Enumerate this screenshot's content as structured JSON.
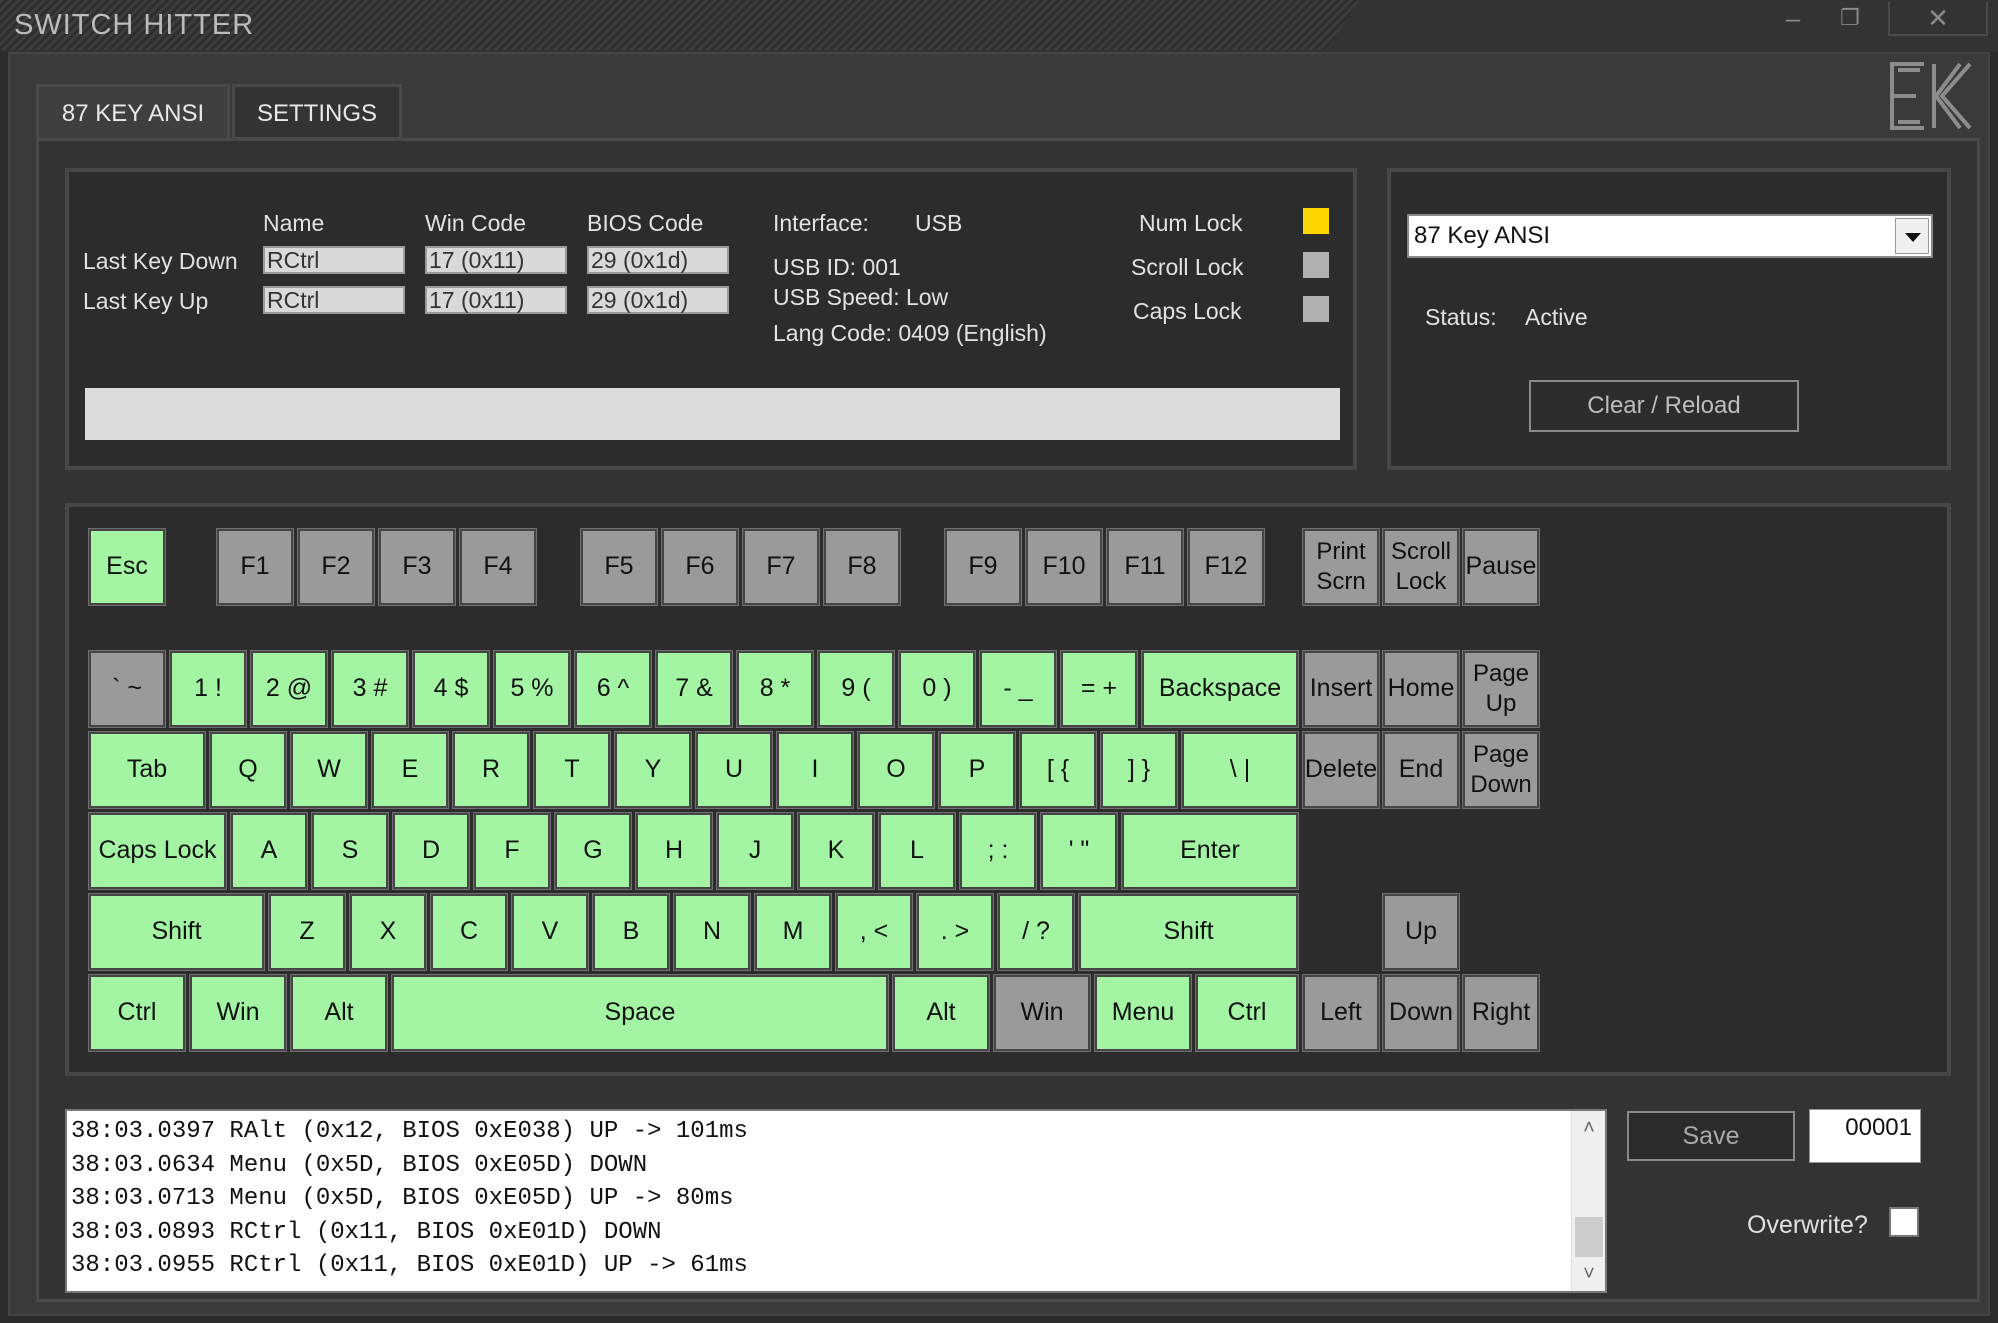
{
  "window": {
    "title": "SWITCH HITTER",
    "controls": {
      "minimize": "–",
      "maximize": "❐",
      "close": "✕"
    }
  },
  "tabs": [
    {
      "label": "87 KEY ANSI",
      "active": true
    },
    {
      "label": "SETTINGS",
      "active": false
    }
  ],
  "logo": "EK",
  "info": {
    "headers": {
      "name": "Name",
      "win_code": "Win Code",
      "bios_code": "BIOS Code"
    },
    "last_key_down": {
      "label": "Last Key Down",
      "name": "RCtrl",
      "win_code": "17 (0x11)",
      "bios_code": "29 (0x1d)"
    },
    "last_key_up": {
      "label": "Last Key Up",
      "name": "RCtrl",
      "win_code": "17 (0x11)",
      "bios_code": "29 (0x1d)"
    },
    "interface_label": "Interface:",
    "interface_value": "USB",
    "usb_id": "USB ID:  001",
    "usb_speed": "USB Speed:  Low",
    "lang_code": "Lang Code:  0409 (English)",
    "locks": [
      {
        "label": "Num Lock",
        "color": "#ffd700"
      },
      {
        "label": "Scroll Lock",
        "color": "#b0b0b0"
      },
      {
        "label": "Caps Lock",
        "color": "#b0b0b0"
      }
    ]
  },
  "profile": {
    "selected": "87 Key ANSI",
    "status_label": "Status:",
    "status_value": "Active",
    "clear_reload": "Clear / Reload"
  },
  "colors": {
    "key_pressed": "#a3f5a4",
    "key_unpressed": "#9a9a9a",
    "num_lock_on": "#ffd700"
  },
  "keyboard": {
    "keys": [
      {
        "label": "Esc",
        "tested": true
      },
      {
        "label": "F1",
        "tested": false
      },
      {
        "label": "F2",
        "tested": false
      },
      {
        "label": "F3",
        "tested": false
      },
      {
        "label": "F4",
        "tested": false
      },
      {
        "label": "F5",
        "tested": false
      },
      {
        "label": "F6",
        "tested": false
      },
      {
        "label": "F7",
        "tested": false
      },
      {
        "label": "F8",
        "tested": false
      },
      {
        "label": "F9",
        "tested": false
      },
      {
        "label": "F10",
        "tested": false
      },
      {
        "label": "F11",
        "tested": false
      },
      {
        "label": "F12",
        "tested": false
      },
      {
        "label": "Print\nScrn",
        "tested": false
      },
      {
        "label": "Scroll\nLock",
        "tested": false
      },
      {
        "label": "Pause",
        "tested": false
      },
      {
        "label": "` ~",
        "tested": false
      },
      {
        "label": "1 !",
        "tested": true
      },
      {
        "label": "2 @",
        "tested": true
      },
      {
        "label": "3 #",
        "tested": true
      },
      {
        "label": "4 $",
        "tested": true
      },
      {
        "label": "5 %",
        "tested": true
      },
      {
        "label": "6 ^",
        "tested": true
      },
      {
        "label": "7 &",
        "tested": true
      },
      {
        "label": "8 *",
        "tested": true
      },
      {
        "label": "9 (",
        "tested": true
      },
      {
        "label": "0 )",
        "tested": true
      },
      {
        "label": "- _",
        "tested": true
      },
      {
        "label": "= +",
        "tested": true
      },
      {
        "label": "Backspace",
        "tested": true
      },
      {
        "label": "Insert",
        "tested": false
      },
      {
        "label": "Home",
        "tested": false
      },
      {
        "label": "Page\nUp",
        "tested": false
      },
      {
        "label": "Tab",
        "tested": true
      },
      {
        "label": "Q",
        "tested": true
      },
      {
        "label": "W",
        "tested": true
      },
      {
        "label": "E",
        "tested": true
      },
      {
        "label": "R",
        "tested": true
      },
      {
        "label": "T",
        "tested": true
      },
      {
        "label": "Y",
        "tested": true
      },
      {
        "label": "U",
        "tested": true
      },
      {
        "label": "I",
        "tested": true
      },
      {
        "label": "O",
        "tested": true
      },
      {
        "label": "P",
        "tested": true
      },
      {
        "label": "[ {",
        "tested": true
      },
      {
        "label": "] }",
        "tested": true
      },
      {
        "label": "\\ |",
        "tested": true
      },
      {
        "label": "Delete",
        "tested": false
      },
      {
        "label": "End",
        "tested": false
      },
      {
        "label": "Page\nDown",
        "tested": false
      },
      {
        "label": "Caps Lock",
        "tested": true
      },
      {
        "label": "A",
        "tested": true
      },
      {
        "label": "S",
        "tested": true
      },
      {
        "label": "D",
        "tested": true
      },
      {
        "label": "F",
        "tested": true
      },
      {
        "label": "G",
        "tested": true
      },
      {
        "label": "H",
        "tested": true
      },
      {
        "label": "J",
        "tested": true
      },
      {
        "label": "K",
        "tested": true
      },
      {
        "label": "L",
        "tested": true
      },
      {
        "label": "; :",
        "tested": true
      },
      {
        "label": "' \"",
        "tested": true
      },
      {
        "label": "Enter",
        "tested": true
      },
      {
        "label": "Shift",
        "tested": true
      },
      {
        "label": "Z",
        "tested": true
      },
      {
        "label": "X",
        "tested": true
      },
      {
        "label": "C",
        "tested": true
      },
      {
        "label": "V",
        "tested": true
      },
      {
        "label": "B",
        "tested": true
      },
      {
        "label": "N",
        "tested": true
      },
      {
        "label": "M",
        "tested": true
      },
      {
        "label": ", <",
        "tested": true
      },
      {
        "label": ". >",
        "tested": true
      },
      {
        "label": "/ ?",
        "tested": true
      },
      {
        "label": "Shift",
        "tested": true
      },
      {
        "label": "Up",
        "tested": false
      },
      {
        "label": "Ctrl",
        "tested": true
      },
      {
        "label": "Win",
        "tested": true
      },
      {
        "label": "Alt",
        "tested": true
      },
      {
        "label": "Space",
        "tested": true
      },
      {
        "label": "Alt",
        "tested": true
      },
      {
        "label": "Win",
        "tested": false
      },
      {
        "label": "Menu",
        "tested": true
      },
      {
        "label": "Ctrl",
        "tested": true
      },
      {
        "label": "Left",
        "tested": false
      },
      {
        "label": "Down",
        "tested": false
      },
      {
        "label": "Right",
        "tested": false
      }
    ]
  },
  "log": {
    "lines": [
      "38:03.0397 RAlt (0x12, BIOS 0xE038) UP -> 101ms",
      "38:03.0634 Menu (0x5D, BIOS 0xE05D) DOWN",
      "38:03.0713 Menu (0x5D, BIOS 0xE05D) UP -> 80ms",
      "38:03.0893 RCtrl (0x11, BIOS 0xE01D) DOWN",
      "38:03.0955 RCtrl (0x11, BIOS 0xE01D) UP -> 61ms"
    ],
    "save_label": "Save",
    "counter": "00001",
    "overwrite_label": "Overwrite?",
    "overwrite_checked": false
  }
}
